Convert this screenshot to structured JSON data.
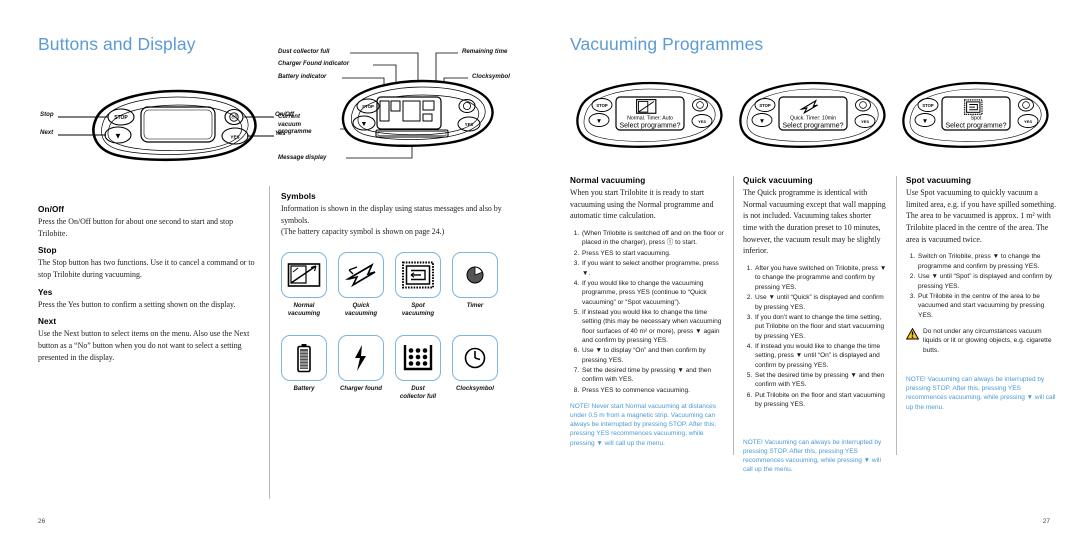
{
  "left_page": {
    "title": "Buttons and Display",
    "page_number": "26",
    "panel_figure": {
      "name": "trilobite-control-panel",
      "callouts": {
        "stop": "Stop",
        "next": "Next",
        "onoff": "On/Off",
        "yes": "Yes"
      },
      "button_glyphs": {
        "stop": "STOP",
        "next": "▼",
        "power": "Ⓘ",
        "yes": "YES"
      }
    },
    "display_figure": {
      "name": "trilobite-display-callouts",
      "callouts": {
        "dust_collector_full": "Dust collector full",
        "charger_found": "Charger Found indicator",
        "battery": "Battery indicator",
        "remaining_time": "Remaining time",
        "clocksymbol": "Clocksymbol",
        "current_programme": "Current\nvacuum\nprogramme",
        "message_display": "Message display"
      }
    },
    "sections": [
      {
        "heading": "On/Off",
        "body": "Press the On/Off button for about one second to start and stop Trilobite."
      },
      {
        "heading": "Stop",
        "body": "The Stop button has two functions. Use it to cancel a command or to stop Trilobite during vacuuming."
      },
      {
        "heading": "Yes",
        "body": "Press the Yes button to confirm a setting shown on the display."
      },
      {
        "heading": "Next",
        "body": "Use the Next button to select items on the menu. Also use the Next button as a “No” button when you do not want to select a setting presented in the display."
      }
    ],
    "symbols_section": {
      "heading": "Symbols",
      "body_line1": "Information is shown in the display using status messages and also by symbols.",
      "body_line2": "(The battery capacity symbol is shown on page 24.)",
      "row1": [
        {
          "icon": "normal-vacuuming-icon",
          "caption": "Normal\nvacuuming"
        },
        {
          "icon": "quick-vacuuming-icon",
          "caption": "Quick\nvacuuming"
        },
        {
          "icon": "spot-vacuuming-icon",
          "caption": "Spot\nvacuuming"
        },
        {
          "icon": "timer-icon",
          "caption": "Timer"
        }
      ],
      "row2": [
        {
          "icon": "battery-icon",
          "caption": "Battery"
        },
        {
          "icon": "charger-found-icon",
          "caption": "Charger found"
        },
        {
          "icon": "dust-collector-full-icon",
          "caption": "Dust\ncollector full"
        },
        {
          "icon": "clocksymbol-icon",
          "caption": "Clocksymbol"
        }
      ]
    }
  },
  "right_page": {
    "title": "Vacuuming Programmes",
    "page_number": "27",
    "device_figures": [
      {
        "name": "device-normal",
        "line1": "Normal. Timer: Auto",
        "line2": "Select programme?",
        "icon": "normal-vacuuming-icon"
      },
      {
        "name": "device-quick",
        "line1": "Quick. Timer: 10min",
        "line2": "Select programme?",
        "icon": "quick-vacuuming-icon"
      },
      {
        "name": "device-spot",
        "line1": "Spot",
        "line2": "Select programme?",
        "icon": "spot-vacuuming-icon"
      }
    ],
    "columns": [
      {
        "heading": "Normal vacuuming",
        "intro": "When you start Trilobite it is ready to start vacuuming using the Normal programme and automatic time calculation.",
        "steps": [
          "(When Trilobite is switched off and on the floor or placed in the charger), press Ⓘ to start.",
          "Press YES to start vacuuming.",
          "If you want to select another programme, press ▼.",
          "If you would like to change the vacuuming programme, press YES (continue to “Quick vacuuming” or “Spot vacuuming”).",
          "If instead you would like to change the time setting (this may be necessary when vacuuming floor surfaces of 40 m² or more), press ▼ again and confirm by pressing YES.",
          "Use ▼ to display “On” and then confirm by pressing YES.",
          "Set the desired time by pressing ▼ and then confirm with YES.",
          "Press YES to commence vacuuming."
        ],
        "note": "NOTE! Never start Normal vacuuming at distances under 0.5 m from a magnetic strip. Vacuuming can always be interrupted by pressing STOP. After this, pressing YES recommences vacuuming, while pressing ▼ will call up the menu."
      },
      {
        "heading": "Quick vacuuming",
        "intro": "The Quick programme is identical with Normal vacuuming except that wall mapping is not included. Vacuuming takes shorter time with the duration preset to 10 minutes, however, the vacuum result may be slightly inferior.",
        "steps": [
          "After you have switched on Trilobite, press ▼ to change the programme and confirm by pressing YES.",
          "Use ▼ until “Quick” is displayed and confirm by pressing YES.",
          "If you don’t want to change the time setting, put Trilobite on the floor and start vacuuming by pressing YES.",
          "If instead you would like to change the time setting, press ▼ until “On” is displayed and confirm by pressing YES.",
          "Set the desired time by pressing ▼ and then confirm with YES.",
          "Put Trilobite on the floor and start vacuuming by pressing YES."
        ],
        "note": "NOTE! Vacuuming can always be interrupted by pressing STOP. After this, pressing YES recommences vacuuming, while pressing ▼ will call up the menu."
      },
      {
        "heading": "Spot vacuuming",
        "intro": "Use Spot vacuuming to quickly vacuum a limited area, e.g. if you have spilled something. The area to be vacuumed is approx. 1 m² with Trilobite placed in the centre of the area. The area is vacuumed twice.",
        "steps": [
          "Switch on Trilobite, press ▼ to change the programme and confirm by pressing YES.",
          "Use ▼ until “Spot” is displayed and confirm by pressing YES.",
          "Put Trilobite in the centre of the area to be vacuumed and start vacuuming by pressing YES."
        ],
        "warning": {
          "icon": "warning-triangle-icon",
          "text": "Do not under any circumstances vacuum liquids or lit or glowing objects, e.g. cigarette butts."
        },
        "note": "NOTE! Vacuuming can always be interrupted by pressing STOP. After this, pressing YES recommences vacuuming, while pressing ▼ will call up the menu."
      }
    ]
  },
  "colors": {
    "heading_blue": "#5b9bd5",
    "note_blue": "#4a9ad4",
    "tile_border": "#7fb4e0",
    "warning_yellow": "#f5c518",
    "rule_gray": "#b9b9b9"
  }
}
